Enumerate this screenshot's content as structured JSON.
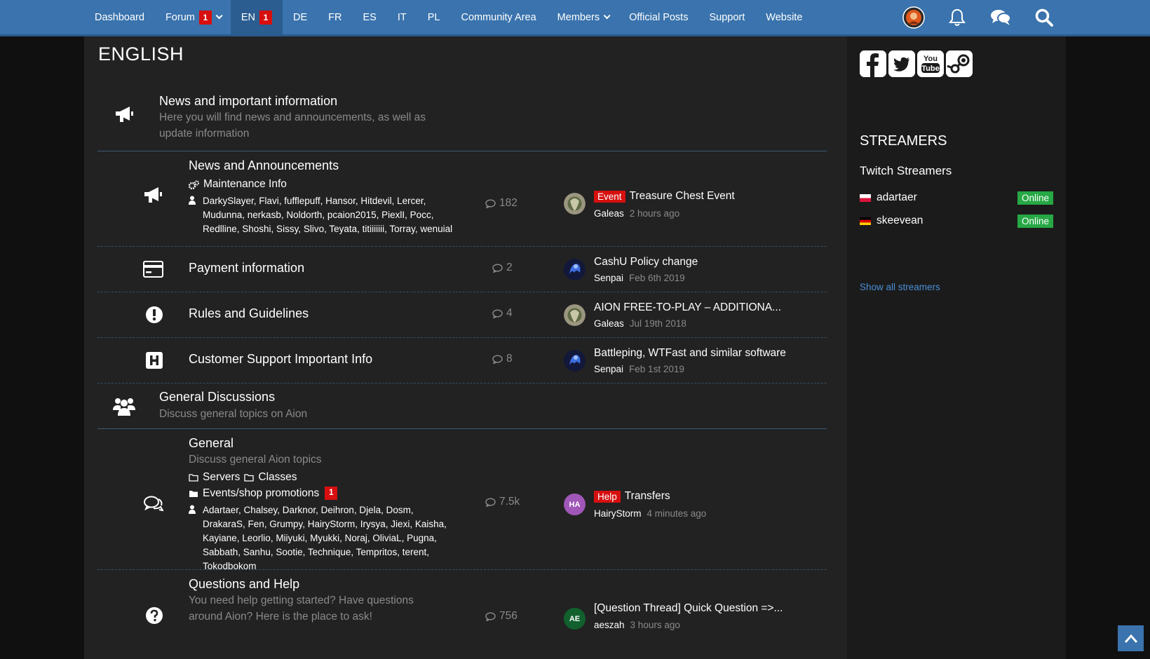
{
  "nav": {
    "dashboard": "Dashboard",
    "forum": "Forum",
    "forum_badge": "1",
    "en": "EN",
    "en_badge": "1",
    "de": "DE",
    "fr": "FR",
    "es": "ES",
    "it": "IT",
    "pl": "PL",
    "community": "Community Area",
    "members": "Members",
    "official": "Official Posts",
    "support": "Support",
    "website": "Website"
  },
  "page": {
    "title": "ENGLISH"
  },
  "categories": {
    "news": {
      "title": "News and important information",
      "desc": "Here you will find news and announcements, as well as update information"
    },
    "general": {
      "title": "General Discussions",
      "desc": "Discuss general topics on Aion"
    }
  },
  "nodes": {
    "announcements": {
      "title": "News and Announcements",
      "sub": "Maintenance Info",
      "mods": "DarkySlayer, Flavi, fufflepuff, Hansor, Hitdevil, Lercer, Mudunna, nerkasb, Noldorth, pcaion2015, PiexlI, Pocc, Redlline, Shoshi, Sissy, Slivo, Teyata, titiiiiiii, Torray, wenuial",
      "count": "182",
      "last_tag": "Event",
      "last_title": "Treasure Chest Event",
      "last_user": "Galeas",
      "last_time": "2 hours ago"
    },
    "payment": {
      "title": "Payment information",
      "count": "2",
      "last_title": "CashU Policy change",
      "last_user": "Senpai",
      "last_time": "Feb 6th 2019"
    },
    "rules": {
      "title": "Rules and Guidelines",
      "count": "4",
      "last_title": "AION FREE-TO-PLAY – ADDITIONA...",
      "last_user": "Galeas",
      "last_time": "Jul 19th 2018"
    },
    "support": {
      "title": "Customer Support Important Info",
      "count": "8",
      "last_title": "Battleping, WTFast and similar software",
      "last_user": "Senpai",
      "last_time": "Feb 1st 2019"
    },
    "general": {
      "title": "General",
      "desc": "Discuss general Aion topics",
      "sub1": "Servers",
      "sub2": "Classes",
      "sub3": "Events/shop promotions",
      "sub3_badge": "1",
      "mods": "Adartaer, Chalsey, Darknor, Deihron, Djela, Dosm, DrakaraS, Fen, Grumpy, HairyStorm, Irysya, Jiexi, Kaisha, Kayiane, Leorlio, Miiyuki, Myukki, Noraj, OliviaL, Pugna, Sabbath, Sanhu, Sootie, Technique, Tempritos, terent, Tokodbokom",
      "count": "7.5k",
      "last_tag": "Help",
      "last_title": "Transfers",
      "last_user": "HairyStorm",
      "last_time": "4 minutes ago",
      "avatar_initials": "HA"
    },
    "questions": {
      "title": "Questions and Help",
      "desc": "You need help getting started? Have questions around Aion? Here is the place to ask!",
      "count": "756",
      "last_title": "[Question Thread] Quick Question =>...",
      "last_user": "aeszah",
      "last_time": "3 hours ago",
      "avatar_initials": "AE"
    }
  },
  "sidebar": {
    "title": "STREAMERS",
    "subtitle": "Twitch Streamers",
    "streamers": [
      {
        "name": "adartaer",
        "status": "Online"
      },
      {
        "name": "skeevean",
        "status": "Online"
      }
    ],
    "show_all": "Show all streamers"
  },
  "colors": {
    "nav": "#3a73ad",
    "badge": "#d70f0f",
    "online": "#26a845",
    "link": "#4a8fd4"
  }
}
